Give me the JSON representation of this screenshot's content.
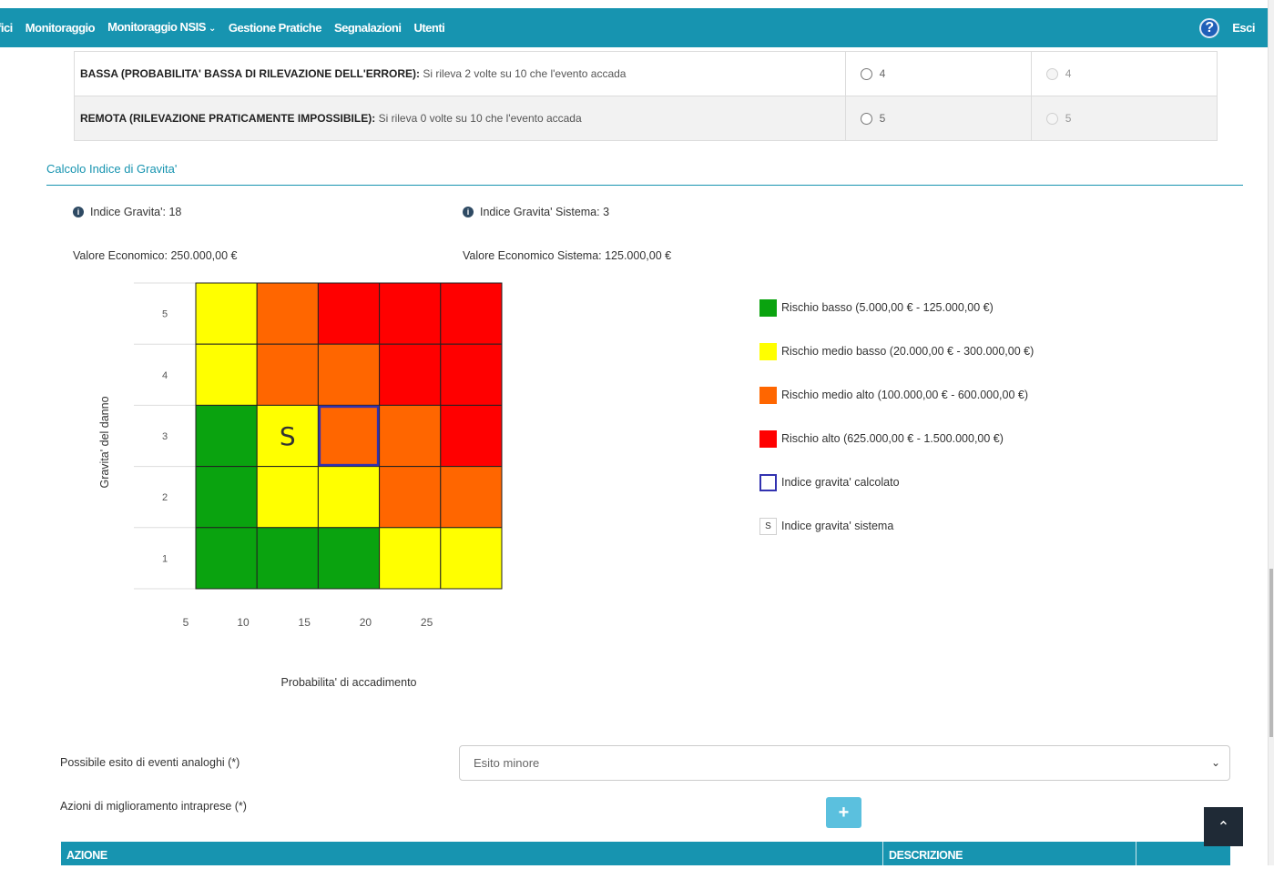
{
  "topbar": {
    "nav": [
      "fici",
      "Monitoraggio",
      "Monitoraggio NSIS",
      "Gestione Pratiche",
      "Segnalazioni",
      "Utenti"
    ],
    "nav_dropdown_icon": "chevron-down-icon",
    "help_icon": "help-icon",
    "help_glyph": "?",
    "exit": "Esci",
    "color": "#1794b0"
  },
  "rilevabilita_rows": [
    {
      "label": "BASSA (PROBABILITA' BASSA DI RILEVAZIONE DELL'ERRORE):",
      "text": "Si rileva 2 volte su 10 che l'evento accada",
      "value": "4",
      "system_value": "4"
    },
    {
      "label": "REMOTA (RILEVAZIONE PRATICAMENTE IMPOSSIBILE):",
      "text": "Si rileva 0 volte su 10 che l'evento accada",
      "value": "5",
      "system_value": "5"
    }
  ],
  "section": {
    "title": "Calcolo Indice di Gravita'"
  },
  "info": {
    "indice_gravita": "Indice Gravita': 18",
    "indice_gravita_sistema": "Indice Gravita' Sistema: 3",
    "valore_economico": "Valore Economico: 250.000,00 €",
    "valore_economico_sistema": "Valore Economico Sistema: 125.000,00 €",
    "info_glyph": "i"
  },
  "chart_data": {
    "type": "heatmap",
    "ylabel": "Gravita' del danno",
    "xlabel": "Probabilita' di accadimento",
    "y_ticks": [
      "5",
      "4",
      "3",
      "2",
      "1"
    ],
    "x_ticks": [
      "5",
      "10",
      "15",
      "20",
      "25"
    ],
    "levels": {
      "G": "#0aa30f",
      "Y": "#ffff00",
      "O": "#ff6600",
      "R": "#ff0000"
    },
    "grid": [
      [
        "Y",
        "O",
        "R",
        "R",
        "R"
      ],
      [
        "Y",
        "O",
        "O",
        "R",
        "R"
      ],
      [
        "G",
        "Y",
        "O",
        "O",
        "R"
      ],
      [
        "G",
        "Y",
        "Y",
        "O",
        "O"
      ],
      [
        "G",
        "G",
        "G",
        "Y",
        "Y"
      ]
    ],
    "calculated_cell": {
      "row": 3,
      "col": 2
    },
    "system_cell": {
      "row": 3,
      "col": 1,
      "label": "S"
    },
    "highlight_color": "#3232b0"
  },
  "legend": [
    {
      "label": "Rischio basso (5.000,00 € - 125.000,00 €)",
      "color": "#0aa30f",
      "kind": "fill"
    },
    {
      "label": "Rischio medio basso (20.000,00 € - 300.000,00 €)",
      "color": "#ffff00",
      "kind": "fill"
    },
    {
      "label": "Rischio medio alto (100.000,00 € - 600.000,00 €)",
      "color": "#ff6600",
      "kind": "fill"
    },
    {
      "label": "Rischio alto (625.000,00 € - 1.500.000,00 €)",
      "color": "#ff0000",
      "kind": "fill"
    },
    {
      "label": "Indice gravita' calcolato",
      "color": "#3232b0",
      "kind": "outline"
    },
    {
      "label": "Indice gravita' sistema",
      "symbol": "S",
      "kind": "s"
    }
  ],
  "form": {
    "esito_label": "Possibile esito di eventi analoghi (*)",
    "esito_value": "Esito minore",
    "azioni_label": "Azioni di miglioramento intraprese (*)",
    "add_glyph": "+",
    "table_headers": [
      "AZIONE",
      "DESCRIZIONE",
      ""
    ]
  },
  "scroll_top_glyph": "⌃"
}
